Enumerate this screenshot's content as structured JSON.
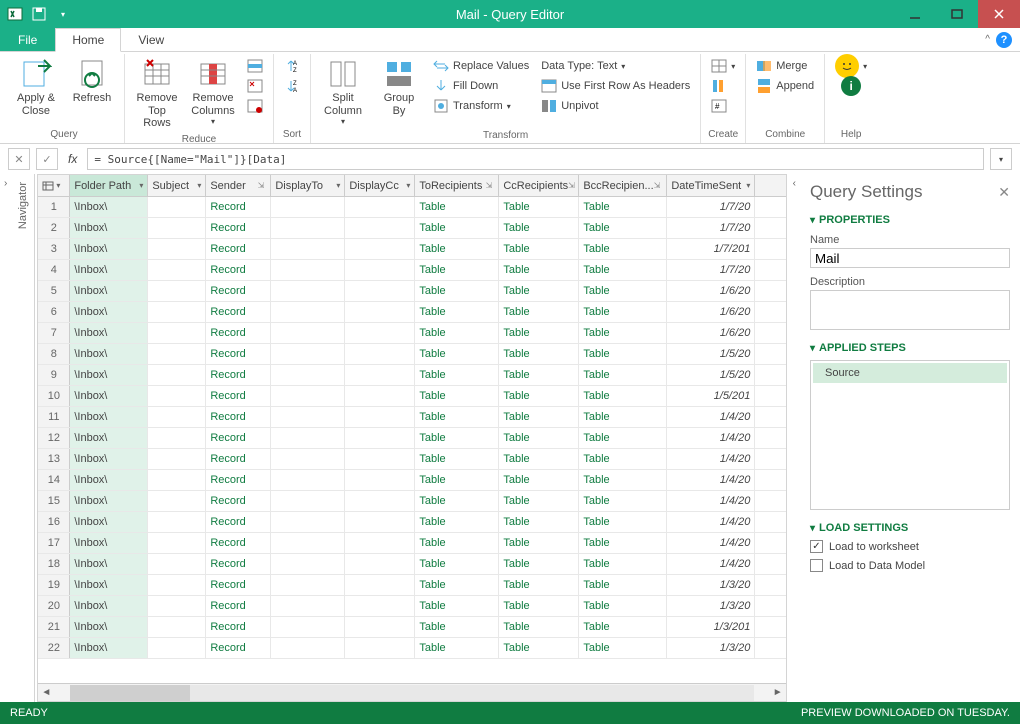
{
  "window_title": "Mail - Query Editor",
  "tabs": {
    "file": "File",
    "home": "Home",
    "view": "View"
  },
  "ribbon": {
    "query": {
      "label": "Query",
      "apply_close": "Apply &\nClose",
      "refresh": "Refresh"
    },
    "reduce": {
      "label": "Reduce",
      "remove_top": "Remove\nTop Rows",
      "remove_cols": "Remove\nColumns"
    },
    "sort": {
      "label": "Sort"
    },
    "split_col": "Split\nColumn",
    "group_by": "Group\nBy",
    "transform": {
      "label": "Transform",
      "replace": "Replace Values",
      "fill_down": "Fill Down",
      "transform_btn": "Transform",
      "data_type": "Data Type: Text",
      "first_row": "Use First Row As Headers",
      "unpivot": "Unpivot"
    },
    "create": {
      "label": "Create"
    },
    "combine": {
      "label": "Combine",
      "merge": "Merge",
      "append": "Append"
    },
    "help": {
      "label": "Help"
    }
  },
  "formula": "= Source{[Name=\"Mail\"]}[Data]",
  "navigator_label": "Navigator",
  "columns": [
    "Folder Path",
    "Subject",
    "Sender",
    "DisplayTo",
    "DisplayCc",
    "ToRecipients",
    "CcRecipients",
    "BccRecipien...",
    "DateTimeSent"
  ],
  "rows": [
    {
      "n": 1,
      "folder": "\\Inbox\\",
      "sender": "Record",
      "to": "Table",
      "cc": "Table",
      "bcc": "Table",
      "dt": "1/7/20"
    },
    {
      "n": 2,
      "folder": "\\Inbox\\",
      "sender": "Record",
      "to": "Table",
      "cc": "Table",
      "bcc": "Table",
      "dt": "1/7/20"
    },
    {
      "n": 3,
      "folder": "\\Inbox\\",
      "sender": "Record",
      "to": "Table",
      "cc": "Table",
      "bcc": "Table",
      "dt": "1/7/201"
    },
    {
      "n": 4,
      "folder": "\\Inbox\\",
      "sender": "Record",
      "to": "Table",
      "cc": "Table",
      "bcc": "Table",
      "dt": "1/7/20"
    },
    {
      "n": 5,
      "folder": "\\Inbox\\",
      "sender": "Record",
      "to": "Table",
      "cc": "Table",
      "bcc": "Table",
      "dt": "1/6/20"
    },
    {
      "n": 6,
      "folder": "\\Inbox\\",
      "sender": "Record",
      "to": "Table",
      "cc": "Table",
      "bcc": "Table",
      "dt": "1/6/20"
    },
    {
      "n": 7,
      "folder": "\\Inbox\\",
      "sender": "Record",
      "to": "Table",
      "cc": "Table",
      "bcc": "Table",
      "dt": "1/6/20"
    },
    {
      "n": 8,
      "folder": "\\Inbox\\",
      "sender": "Record",
      "to": "Table",
      "cc": "Table",
      "bcc": "Table",
      "dt": "1/5/20"
    },
    {
      "n": 9,
      "folder": "\\Inbox\\",
      "sender": "Record",
      "to": "Table",
      "cc": "Table",
      "bcc": "Table",
      "dt": "1/5/20"
    },
    {
      "n": 10,
      "folder": "\\Inbox\\",
      "sender": "Record",
      "to": "Table",
      "cc": "Table",
      "bcc": "Table",
      "dt": "1/5/201"
    },
    {
      "n": 11,
      "folder": "\\Inbox\\",
      "sender": "Record",
      "to": "Table",
      "cc": "Table",
      "bcc": "Table",
      "dt": "1/4/20"
    },
    {
      "n": 12,
      "folder": "\\Inbox\\",
      "sender": "Record",
      "to": "Table",
      "cc": "Table",
      "bcc": "Table",
      "dt": "1/4/20"
    },
    {
      "n": 13,
      "folder": "\\Inbox\\",
      "sender": "Record",
      "to": "Table",
      "cc": "Table",
      "bcc": "Table",
      "dt": "1/4/20"
    },
    {
      "n": 14,
      "folder": "\\Inbox\\",
      "sender": "Record",
      "to": "Table",
      "cc": "Table",
      "bcc": "Table",
      "dt": "1/4/20"
    },
    {
      "n": 15,
      "folder": "\\Inbox\\",
      "sender": "Record",
      "to": "Table",
      "cc": "Table",
      "bcc": "Table",
      "dt": "1/4/20"
    },
    {
      "n": 16,
      "folder": "\\Inbox\\",
      "sender": "Record",
      "to": "Table",
      "cc": "Table",
      "bcc": "Table",
      "dt": "1/4/20"
    },
    {
      "n": 17,
      "folder": "\\Inbox\\",
      "sender": "Record",
      "to": "Table",
      "cc": "Table",
      "bcc": "Table",
      "dt": "1/4/20"
    },
    {
      "n": 18,
      "folder": "\\Inbox\\",
      "sender": "Record",
      "to": "Table",
      "cc": "Table",
      "bcc": "Table",
      "dt": "1/4/20"
    },
    {
      "n": 19,
      "folder": "\\Inbox\\",
      "sender": "Record",
      "to": "Table",
      "cc": "Table",
      "bcc": "Table",
      "dt": "1/3/20"
    },
    {
      "n": 20,
      "folder": "\\Inbox\\",
      "sender": "Record",
      "to": "Table",
      "cc": "Table",
      "bcc": "Table",
      "dt": "1/3/20"
    },
    {
      "n": 21,
      "folder": "\\Inbox\\",
      "sender": "Record",
      "to": "Table",
      "cc": "Table",
      "bcc": "Table",
      "dt": "1/3/201"
    },
    {
      "n": 22,
      "folder": "\\Inbox\\",
      "sender": "Record",
      "to": "Table",
      "cc": "Table",
      "bcc": "Table",
      "dt": "1/3/20"
    }
  ],
  "settings": {
    "title": "Query Settings",
    "properties": "PROPERTIES",
    "name_lbl": "Name",
    "name_val": "Mail",
    "desc_lbl": "Description",
    "applied": "APPLIED STEPS",
    "step1": "Source",
    "load": "LOAD SETTINGS",
    "load_ws": "Load to worksheet",
    "load_dm": "Load to Data Model"
  },
  "status": {
    "ready": "READY",
    "preview": "PREVIEW DOWNLOADED ON TUESDAY."
  }
}
